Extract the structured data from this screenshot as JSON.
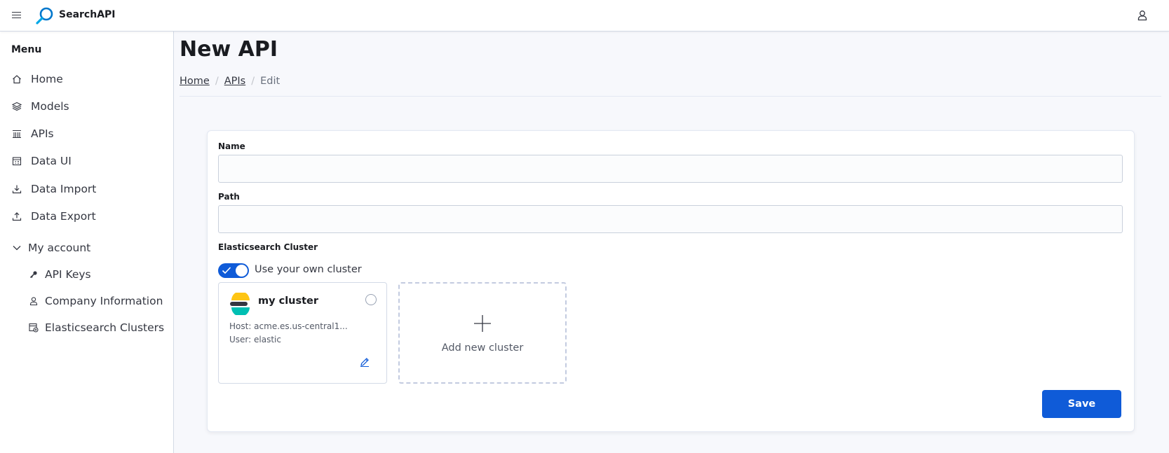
{
  "app": {
    "title": "SearchAPI",
    "brand_color": "#0077cc",
    "accent_color": "#0f5bd8"
  },
  "header": {
    "menu_icon": "hamburger-icon",
    "user_icon": "user-icon"
  },
  "sidebar": {
    "title": "Menu",
    "items": [
      {
        "label": "Home",
        "icon": "home-icon"
      },
      {
        "label": "Models",
        "icon": "layers-icon"
      },
      {
        "label": "APIs",
        "icon": "api-icon"
      },
      {
        "label": "Data UI",
        "icon": "table-icon"
      },
      {
        "label": "Data Import",
        "icon": "download-icon"
      },
      {
        "label": "Data Export",
        "icon": "upload-icon"
      }
    ],
    "account": {
      "label": "My account",
      "icon": "chevron-down-icon",
      "items": [
        {
          "label": "API Keys",
          "icon": "key-icon"
        },
        {
          "label": "Company Information",
          "icon": "user-icon"
        },
        {
          "label": "Elasticsearch Clusters",
          "icon": "cluster-icon"
        }
      ]
    }
  },
  "page": {
    "title": "New API",
    "breadcrumb": [
      "Home",
      "APIs",
      "Edit"
    ]
  },
  "form": {
    "name": {
      "label": "Name",
      "value": "",
      "placeholder": ""
    },
    "path": {
      "label": "Path",
      "value": "",
      "placeholder": ""
    },
    "cluster_section": {
      "label": "Elasticsearch Cluster",
      "toggle_label": "Use your own cluster",
      "toggle_on": true,
      "cluster": {
        "name": "my cluster",
        "host": "Host: acme.es.us-central1...",
        "user": "User: elastic",
        "selected": false
      },
      "add_label": "Add new cluster"
    },
    "save_label": "Save"
  }
}
